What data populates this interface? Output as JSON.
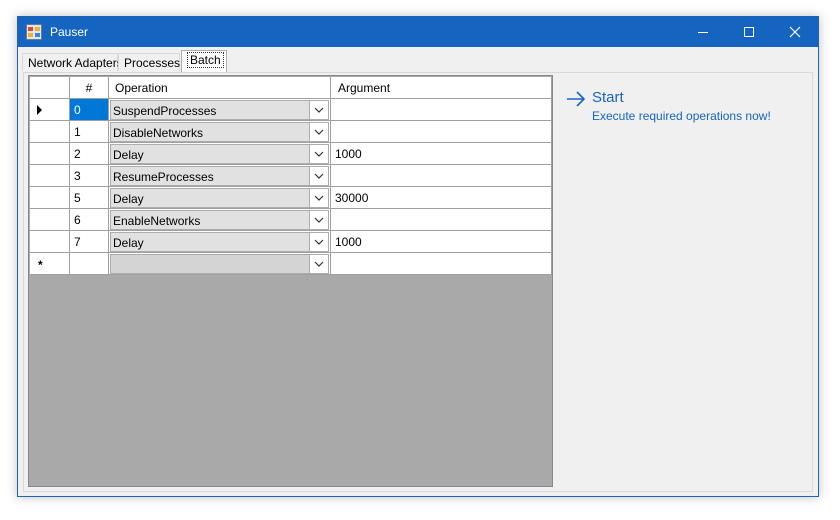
{
  "window": {
    "title": "Pauser",
    "controls": {
      "minimize": "minimize-icon",
      "maximize": "maximize-icon",
      "close": "close-icon"
    },
    "accent_color": "#1565c0"
  },
  "tabs": [
    {
      "label": "Network Adapters",
      "active": false
    },
    {
      "label": "Processes",
      "active": false
    },
    {
      "label": "Batch",
      "active": true
    }
  ],
  "grid": {
    "columns": [
      "#",
      "Operation",
      "Argument"
    ],
    "rows": [
      {
        "indicator": "current",
        "num": "0",
        "operation": "SuspendProcesses",
        "argument": ""
      },
      {
        "indicator": "",
        "num": "1",
        "operation": "DisableNetworks",
        "argument": ""
      },
      {
        "indicator": "",
        "num": "2",
        "operation": "Delay",
        "argument": "1000"
      },
      {
        "indicator": "",
        "num": "3",
        "operation": "ResumeProcesses",
        "argument": ""
      },
      {
        "indicator": "",
        "num": "5",
        "operation": "Delay",
        "argument": "30000"
      },
      {
        "indicator": "",
        "num": "6",
        "operation": "EnableNetworks",
        "argument": ""
      },
      {
        "indicator": "",
        "num": "7",
        "operation": "Delay",
        "argument": "1000"
      }
    ],
    "new_row": {
      "indicator": "*",
      "num": "",
      "operation": "",
      "argument": ""
    },
    "selection_color": "#0078d7"
  },
  "start": {
    "label": "Start",
    "description": "Execute required operations now!",
    "icon": "arrow-right-icon"
  }
}
